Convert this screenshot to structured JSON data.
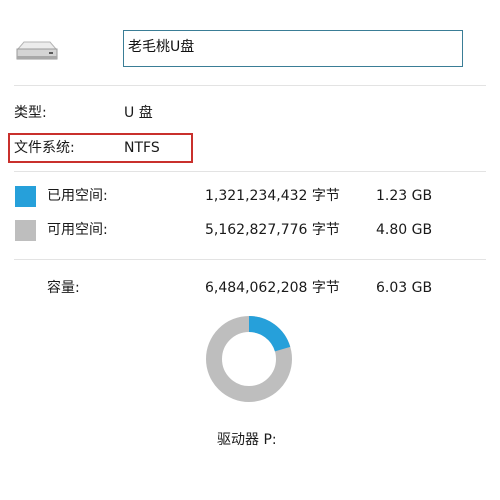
{
  "header": {
    "drive_name": "老毛桃U盘",
    "icon": "usb-drive-icon"
  },
  "info": {
    "type_label": "类型:",
    "type_value": "U 盘",
    "fs_label": "文件系统:",
    "fs_value": "NTFS"
  },
  "space": {
    "used_label": "已用空间:",
    "used_bytes": "1,321,234,432 字节",
    "used_size": "1.23 GB",
    "free_label": "可用空间:",
    "free_bytes": "5,162,827,776 字节",
    "free_size": "4.80 GB",
    "capacity_label": "容量:",
    "capacity_bytes": "6,484,062,208 字节",
    "capacity_size": "6.03 GB",
    "used_fraction": 0.2038
  },
  "drive_letter_label": "驱动器 P:",
  "colors": {
    "used": "#26a0da",
    "free": "#bebebe",
    "highlight": "#c9302c",
    "input_border": "#3a7d96"
  }
}
